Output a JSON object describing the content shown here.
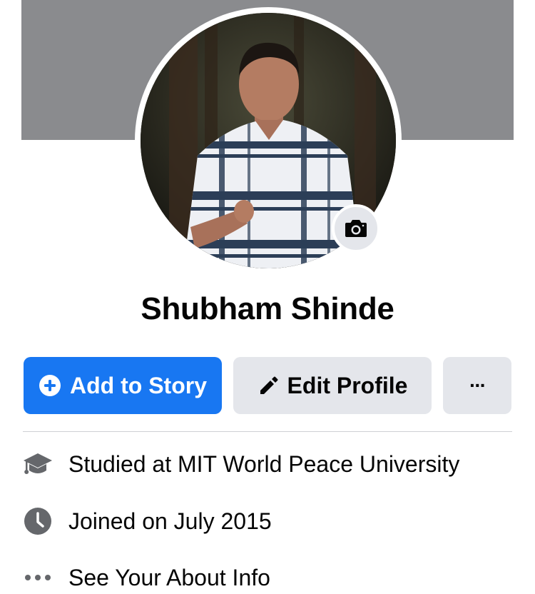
{
  "profile": {
    "name": "Shubham Shinde",
    "avatar_icon": "profile-photo",
    "camera_icon": "camera-icon"
  },
  "actions": {
    "add_story_label": "Add to Story",
    "edit_profile_label": "Edit Profile",
    "more_label": "···"
  },
  "intro": {
    "studied_prefix": "Studied at ",
    "studied_school": "MIT World Peace University",
    "joined": "Joined on July 2015",
    "see_about": "See Your About Info"
  },
  "colors": {
    "accent": "#1877f2",
    "secondary_button": "#e4e6eb",
    "cover": "#8a8b8e",
    "icon_gray": "#65676b"
  }
}
